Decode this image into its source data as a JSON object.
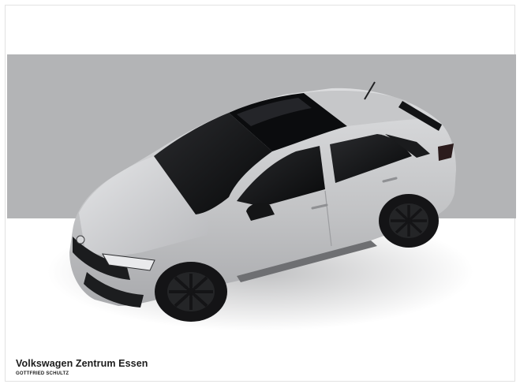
{
  "photo": {
    "subject": "silver-coupe-suv",
    "background_band_color": "#b3b4b6",
    "paint_color": "#c9cacc",
    "roof_color": "#0e0f11",
    "wheel_color": "#141416"
  },
  "caption": {
    "dealer_name": "Volkswagen Zentrum Essen",
    "dealer_subtitle": "GOTTFRIED SCHULTZ"
  }
}
